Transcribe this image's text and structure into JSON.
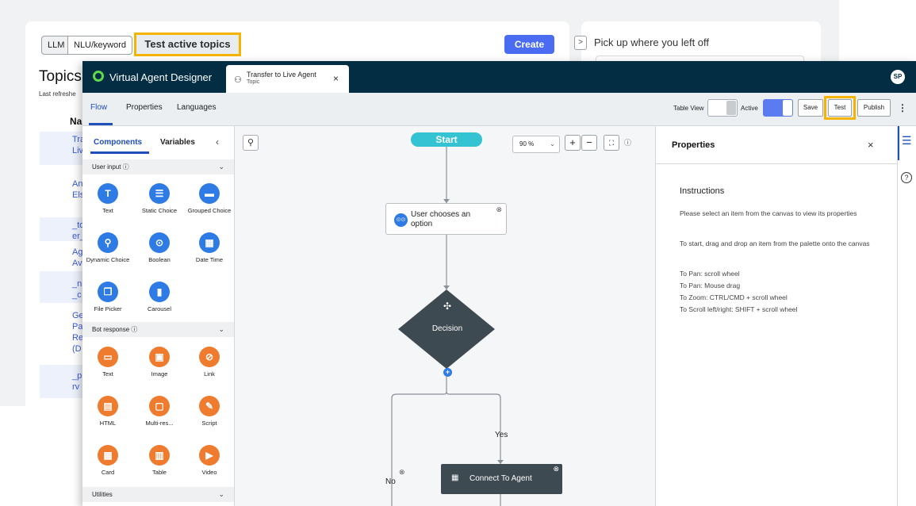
{
  "background": {
    "seg_llm": "LLM",
    "seg_nlu": "NLU/keyword",
    "test_active_topics": "Test active topics",
    "create": "Create",
    "pickup_chevron": ">",
    "pickup_title": "Pick up where you left off",
    "topics_title": "Topics",
    "last_refreshed": "Last refreshe",
    "name_col": "Na",
    "links": [
      "Tra",
      "Liv",
      "An",
      "Els",
      "_to",
      "er_",
      "Ag",
      "Av",
      "_n",
      "_c",
      "Ge",
      "Pa",
      "Re",
      "(D",
      "_p",
      "rv"
    ]
  },
  "app": {
    "title": "Virtual Agent Designer",
    "avatar": "SP",
    "tab": {
      "icon": "tree-icon",
      "title": "Transfer to Live Agent",
      "subtitle": "Topic",
      "close": "×"
    }
  },
  "toolbar": {
    "tabs": [
      "Flow",
      "Properties",
      "Languages"
    ],
    "table_view": "Table View",
    "active": "Active",
    "save": "Save",
    "test": "Test",
    "publish": "Publish",
    "more": "⋮"
  },
  "palette": {
    "tab_components": "Components",
    "tab_variables": "Variables",
    "collapse": "‹",
    "user_input": "User input ⓘ",
    "bot_response": "Bot response ⓘ",
    "utilities": "Utilities",
    "chev": "⌄",
    "user_input_items": [
      {
        "label": "Text",
        "glyph": "T"
      },
      {
        "label": "Static Choice",
        "glyph": "☰"
      },
      {
        "label": "Grouped Choice",
        "glyph": "▬"
      },
      {
        "label": "Dynamic Choice",
        "glyph": "⚲"
      },
      {
        "label": "Boolean",
        "glyph": "⊙"
      },
      {
        "label": "Date Time",
        "glyph": "▦"
      },
      {
        "label": "File Picker",
        "glyph": "❐"
      },
      {
        "label": "Carousel",
        "glyph": "▮"
      }
    ],
    "bot_response_items": [
      {
        "label": "Text",
        "glyph": "▭"
      },
      {
        "label": "Image",
        "glyph": "▣"
      },
      {
        "label": "Link",
        "glyph": "⊘"
      },
      {
        "label": "HTML",
        "glyph": "▤"
      },
      {
        "label": "Multi-res...",
        "glyph": "▢"
      },
      {
        "label": "Script",
        "glyph": "✎"
      },
      {
        "label": "Card",
        "glyph": "▦"
      },
      {
        "label": "Table",
        "glyph": "▥"
      },
      {
        "label": "Video",
        "glyph": "▶"
      }
    ]
  },
  "canvas": {
    "search": "⚲",
    "start": "Start",
    "zoom": "90 %",
    "zoom_chev": "⌄",
    "zoom_in": "+",
    "zoom_out": "−",
    "fit": "⛶",
    "info": "ⓘ",
    "user_node": "User chooses an option",
    "user_node_icon": "⊙⊙",
    "node_close": "⊗",
    "decision": "Decision",
    "decision_icon": "✣",
    "add": "+",
    "yes": "Yes",
    "no": "No",
    "agent_node": "Connect To Agent",
    "agent_icon": "▦"
  },
  "properties": {
    "title": "Properties",
    "close": "×",
    "instructions_title": "Instructions",
    "lines": [
      "Please select an item from the canvas to view its properties",
      "To start, drag and drop an item from the palette onto the canvas",
      "To Pan: scroll wheel",
      "To Pan: Mouse drag",
      "To Zoom: CTRL/CMD + scroll wheel",
      "To Scroll left/right: SHIFT + scroll wheel"
    ]
  },
  "rail": {
    "props_icon": "☰",
    "help_icon": "?"
  },
  "colors": {
    "topbar": "#032d42",
    "accent_blue": "#1f4fb8",
    "highlight": "#f5b400",
    "start": "#33c3d3",
    "decision": "#3e4a52",
    "palette_blue": "#2f7be5",
    "palette_orange": "#ef7b2e"
  }
}
